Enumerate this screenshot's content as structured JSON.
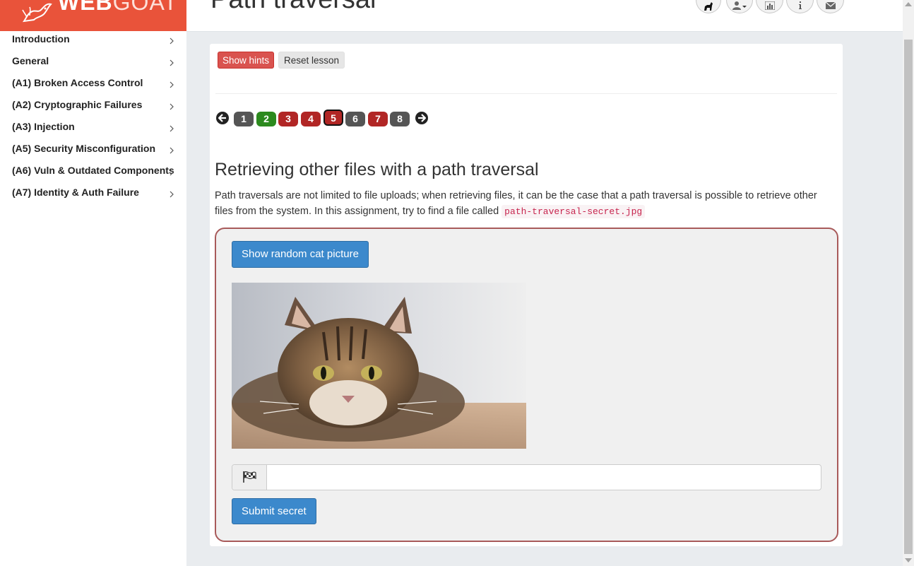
{
  "brand": {
    "logo_bold": "WEB",
    "logo_light": "GOAT"
  },
  "header": {
    "title": "Path traversal"
  },
  "sidebar": {
    "items": [
      {
        "label": "Introduction"
      },
      {
        "label": "General"
      },
      {
        "label": "(A1) Broken Access Control"
      },
      {
        "label": "(A2) Cryptographic Failures"
      },
      {
        "label": "(A3) Injection"
      },
      {
        "label": "(A5) Security Misconfiguration"
      },
      {
        "label": "(A6) Vuln & Outdated Components"
      },
      {
        "label": "(A7) Identity & Auth Failure"
      }
    ]
  },
  "toolbar": {
    "show_hints": "Show hints",
    "reset_lesson": "Reset lesson"
  },
  "pager": {
    "pages": [
      {
        "label": "1",
        "status": "grey"
      },
      {
        "label": "2",
        "status": "green"
      },
      {
        "label": "3",
        "status": "red"
      },
      {
        "label": "4",
        "status": "red"
      },
      {
        "label": "5",
        "status": "current"
      },
      {
        "label": "6",
        "status": "grey"
      },
      {
        "label": "7",
        "status": "red"
      },
      {
        "label": "8",
        "status": "grey"
      }
    ]
  },
  "lesson": {
    "title": "Retrieving other files with a path traversal",
    "text_before": "Path traversals are not limited to file uploads; when retrieving files, it can be the case that a path traversal is possible to retrieve other files from the system. In this assignment, try to find a file called ",
    "code": "path-traversal-secret.jpg"
  },
  "assignment": {
    "cat_button": "Show random cat picture",
    "secret_value": "",
    "submit_button": "Submit secret"
  },
  "colors": {
    "brand": "#e9533a",
    "danger": "#d9534f",
    "primary": "#3c89cc",
    "page_green": "#2c8a1e",
    "page_red": "#b12625",
    "page_grey": "#555555"
  },
  "icons": [
    "goat-logo-icon",
    "goat-icon",
    "user-icon",
    "bar-chart-icon",
    "info-icon",
    "envelope-icon",
    "chevron-right-icon",
    "arrow-left-icon",
    "arrow-right-icon",
    "flag-checkered-icon"
  ]
}
